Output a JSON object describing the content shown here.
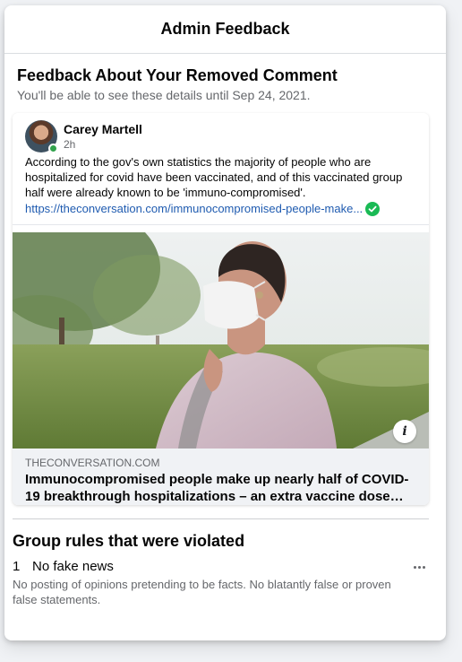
{
  "dialog": {
    "title": "Admin Feedback"
  },
  "feedback": {
    "title": "Feedback About Your Removed Comment",
    "subtitle": "You'll be able to see these details until Sep 24, 2021."
  },
  "comment": {
    "author": "Carey Martell",
    "time": "2h",
    "text": "According to the gov's own statistics the majority of people who are hospitalized for covid have been vaccinated, and of this vaccinated group half were already known to be 'immuno-compromised'.",
    "link": "https://theconversation.com/immunocompromised-people-make..."
  },
  "link_preview": {
    "domain": "THECONVERSATION.COM",
    "title": "Immunocompromised people make up nearly half of COVID-19 breakthrough hospitalizations – an extra vaccine dose m..."
  },
  "rules": {
    "title": "Group rules that were violated",
    "items": [
      {
        "number": "1",
        "name": "No fake news",
        "description": "No posting of opinions pretending to be facts. No blatantly false or proven false statements."
      }
    ]
  },
  "icons": {
    "online": "online-status-dot",
    "verified": "check-circle-icon",
    "info": "info-icon",
    "more": "more-horizontal-icon"
  },
  "colors": {
    "link": "#1f5bb0",
    "verified": "#1aba55",
    "online": "#31a24c",
    "secondary_text": "#65676b"
  }
}
